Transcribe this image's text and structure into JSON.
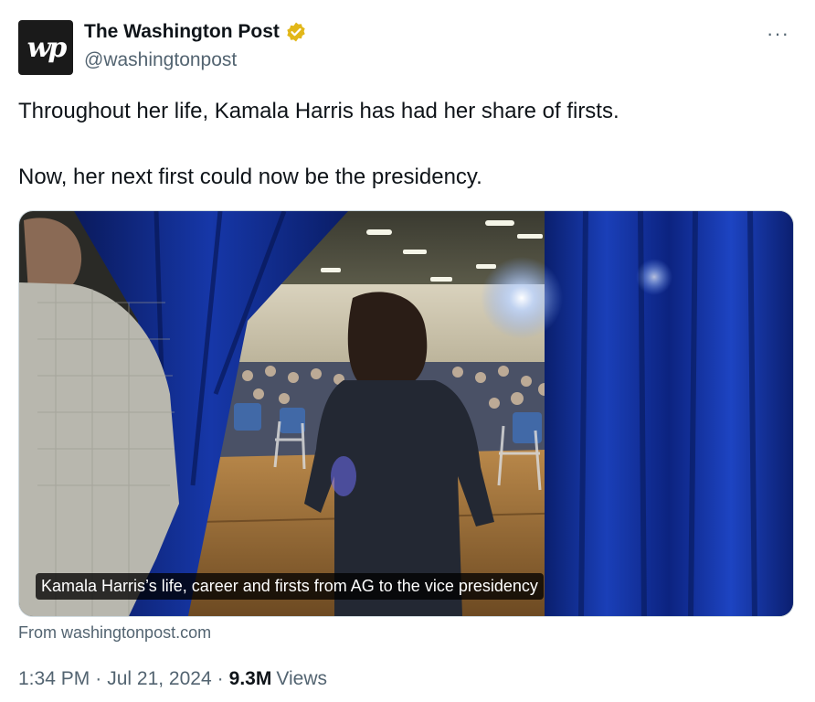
{
  "author": {
    "avatar_text": "wp",
    "display_name": "The Washington Post",
    "handle": "@washingtonpost",
    "verified_badge_color": "#E2B719"
  },
  "menu": {
    "more_label": "···"
  },
  "tweet": {
    "line1": "Throughout her life, Kamala Harris has had her share of firsts.",
    "line2": "Now, her next first could now be the presidency."
  },
  "card": {
    "caption": "Kamala Harris’s life, career and firsts from AG to the vice presidency",
    "source": "From washingtonpost.com"
  },
  "meta": {
    "time": "1:34 PM",
    "separator": "·",
    "date": "Jul 21, 2024",
    "views_count": "9.3M",
    "views_label": "Views"
  },
  "colors": {
    "text_primary": "#0F1419",
    "text_secondary": "#536471",
    "curtain_blue": "#0E2A8A"
  }
}
